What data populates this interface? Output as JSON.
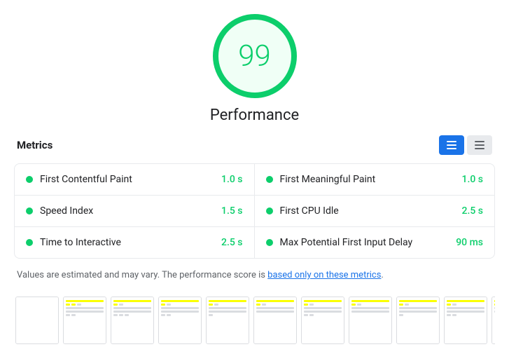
{
  "score": {
    "value": "99",
    "label": "Performance"
  },
  "metrics_header": {
    "title": "Metrics",
    "toggle_list_label": "List view",
    "toggle_grid_label": "Grid view"
  },
  "metrics": [
    {
      "name": "First Contentful Paint",
      "value": "1.0 s",
      "column": "left"
    },
    {
      "name": "First Meaningful Paint",
      "value": "1.0 s",
      "column": "right"
    },
    {
      "name": "Speed Index",
      "value": "1.5 s",
      "column": "left"
    },
    {
      "name": "First CPU Idle",
      "value": "2.5 s",
      "column": "right"
    },
    {
      "name": "Time to Interactive",
      "value": "2.5 s",
      "column": "left"
    },
    {
      "name": "Max Potential First Input Delay",
      "value": "90 ms",
      "column": "right"
    }
  ],
  "note": {
    "text_before": "Values are estimated and may vary. The performance score is ",
    "link_text": "based only on these metrics",
    "text_after": "."
  },
  "filmstrip": {
    "frames": [
      0,
      1,
      2,
      3,
      4,
      5,
      6,
      7,
      8,
      9,
      10
    ]
  }
}
